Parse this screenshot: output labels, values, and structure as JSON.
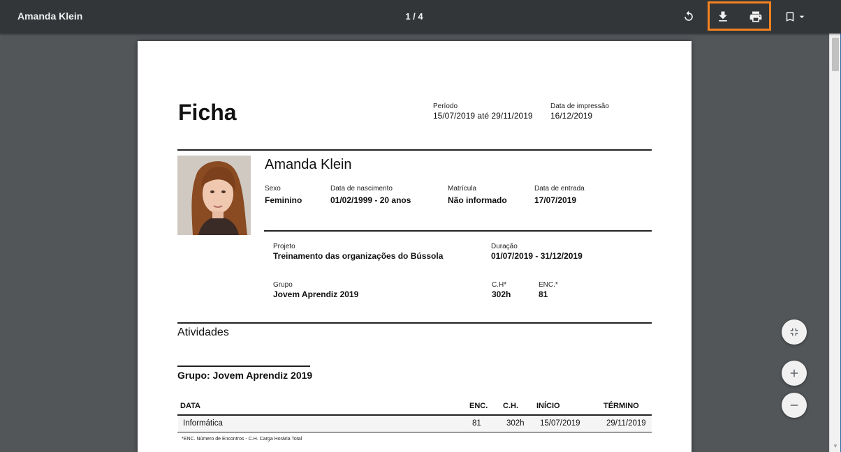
{
  "toolbar": {
    "title": "Amanda Klein",
    "page_indicator": "1 / 4",
    "icons": [
      "rotate-icon",
      "download-icon",
      "print-icon",
      "bookmark-icon",
      "dropdown-arrow-icon"
    ],
    "highlight_color": "#f5821f"
  },
  "document": {
    "heading": "Ficha",
    "period_label": "Período",
    "period_value": "15/07/2019 até 29/11/2019",
    "print_date_label": "Data de impressão",
    "print_date_value": "16/12/2019",
    "person_name": "Amanda Klein",
    "sex_label": "Sexo",
    "sex_value": "Feminino",
    "birth_label": "Data de nascimento",
    "birth_value": "01/02/1999 - 20 anos",
    "enrollment_label": "Matrícula",
    "enrollment_value": "Não informado",
    "entry_label": "Data de entrada",
    "entry_value": "17/07/2019",
    "project_label": "Projeto",
    "project_value": "Treinamento das organizações do Bússola",
    "duration_label": "Duração",
    "duration_value": "01/07/2019 - 31/12/2019",
    "group_label": "Grupo",
    "group_value": "Jovem Aprendiz 2019",
    "ch_label": "C.H*",
    "ch_value": "302h",
    "enc_label": "ENC.*",
    "enc_value": "81",
    "activities_heading": "Atividades",
    "group_heading": "Grupo: Jovem Aprendiz 2019",
    "table": {
      "headers": [
        "DATA",
        "ENC.",
        "C.H.",
        "INÍCIO",
        "TÉRMINO"
      ],
      "rows": [
        [
          "Informática",
          "81",
          "302h",
          "15/07/2019",
          "29/11/2019"
        ]
      ]
    },
    "footnote": "*ENC. Número de Encontros - C.H. Carga Horária Total"
  },
  "zoom_controls": {
    "icons": [
      "fit-page-icon",
      "zoom-in-icon",
      "zoom-out-icon"
    ]
  }
}
